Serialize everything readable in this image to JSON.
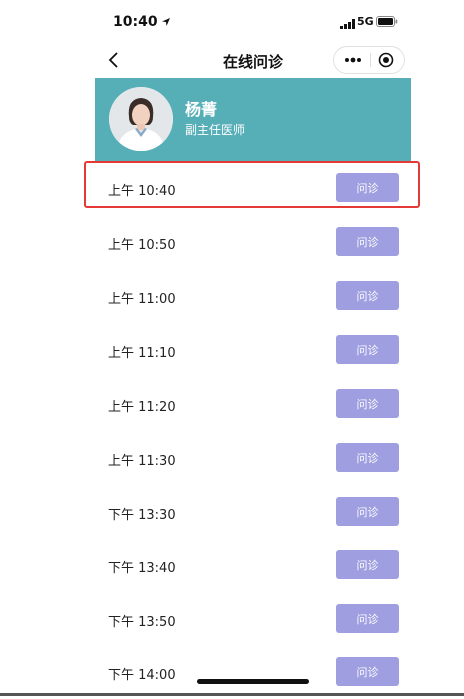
{
  "status_bar": {
    "time": "10:40",
    "network": "5G"
  },
  "nav": {
    "title": "在线问诊"
  },
  "doctor": {
    "name": "杨菁",
    "title": "副主任医师"
  },
  "slots": [
    {
      "time": "上午 10:40",
      "button": "问诊"
    },
    {
      "time": "上午 10:50",
      "button": "问诊"
    },
    {
      "time": "上午 11:00",
      "button": "问诊"
    },
    {
      "time": "上午 11:10",
      "button": "问诊"
    },
    {
      "time": "上午 11:20",
      "button": "问诊"
    },
    {
      "time": "上午 11:30",
      "button": "问诊"
    },
    {
      "time": "下午 13:30",
      "button": "问诊"
    },
    {
      "time": "下午 13:40",
      "button": "问诊"
    },
    {
      "time": "下午 13:50",
      "button": "问诊"
    },
    {
      "time": "下午 14:00",
      "button": "问诊"
    }
  ],
  "colors": {
    "header_bg": "#56aeb7",
    "button_bg": "#9e9ee0",
    "highlight_border": "#e53935"
  },
  "icons": [
    "location-arrow-icon",
    "signal-icon",
    "battery-icon",
    "back-chevron-icon",
    "more-dots-icon",
    "target-circle-icon"
  ]
}
